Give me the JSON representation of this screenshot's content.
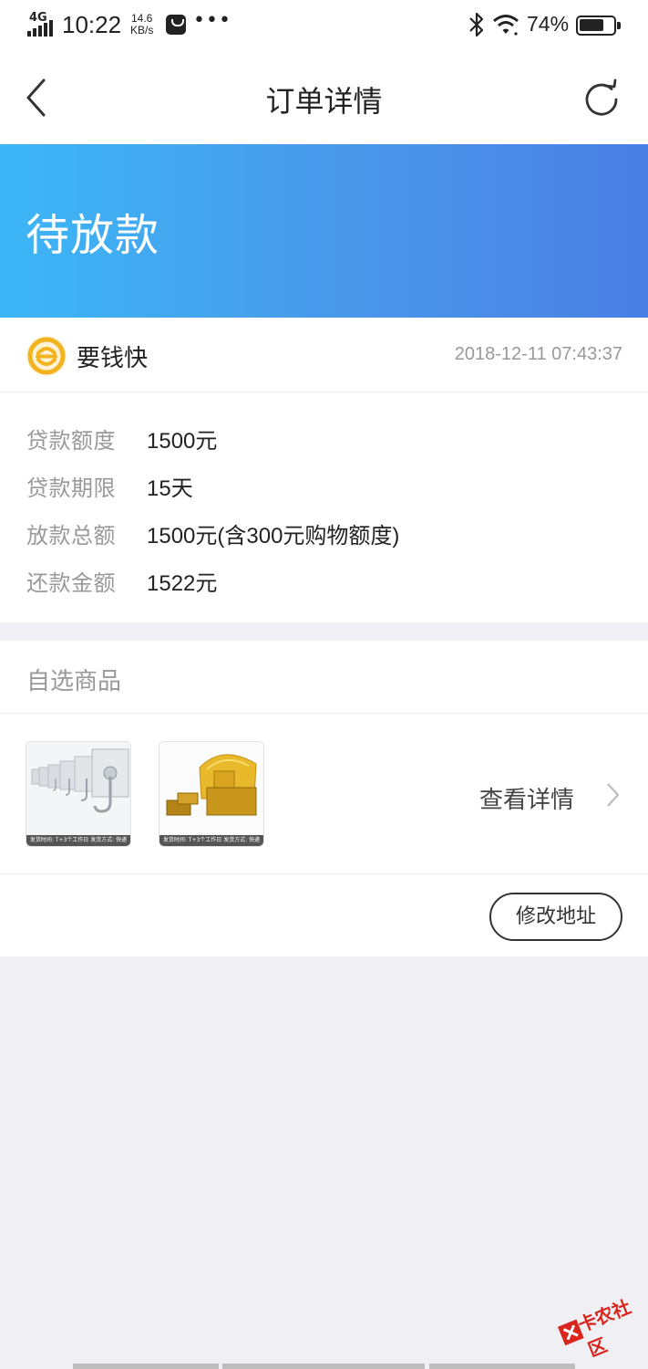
{
  "status_bar": {
    "network": "4G",
    "time": "10:22",
    "speed_value": "14.6",
    "speed_unit": "KB/s",
    "more": "•••",
    "battery_percent_text": "74%",
    "battery_level": 0.74
  },
  "nav": {
    "title": "订单详情"
  },
  "banner": {
    "status": "待放款",
    "gradient_start": "#3cb6f6",
    "gradient_end": "#4a7fe4"
  },
  "order": {
    "merchant": "要钱快",
    "time": "2018-12-11 07:43:37",
    "logo_color": "#f3b321",
    "details": [
      {
        "label": "贷款额度",
        "value": "1500元"
      },
      {
        "label": "贷款期限",
        "value": "15天"
      },
      {
        "label": "放款总额",
        "value": "1500元(含300元购物额度)"
      },
      {
        "label": "还款金额",
        "value": "1522元"
      }
    ]
  },
  "goods": {
    "title": "自选商品",
    "items": [
      {
        "caption": "发货时间: T+3个工作日 发货方式: 快递"
      },
      {
        "caption": "发货时间: T+3个工作日 发货方式: 快递"
      }
    ],
    "view_details": "查看详情",
    "modify_address": "修改地址"
  },
  "watermark": {
    "text": "卡农社区"
  }
}
